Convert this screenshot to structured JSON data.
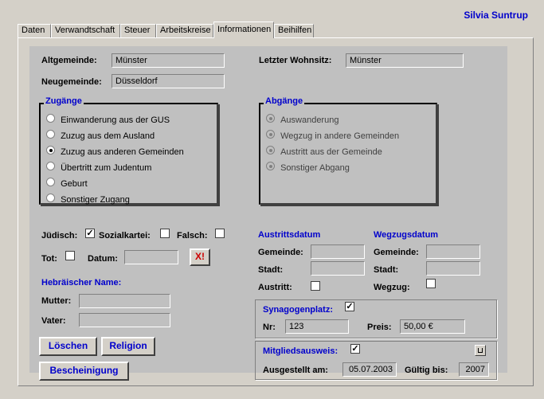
{
  "user": "Silvia Suntrup",
  "tabs": [
    "Daten",
    "Verwandtschaft",
    "Steuer",
    "Arbeitskreise",
    "Informationen",
    "Beihilfen"
  ],
  "altgemeinde": {
    "label": "Altgemeinde:",
    "value": "Münster"
  },
  "neugemeinde": {
    "label": "Neugemeinde:",
    "value": "Düsseldorf"
  },
  "wohnsitz": {
    "label": "Letzter Wohnsitz:",
    "value": "Münster"
  },
  "zugaenge": {
    "title": "Zugänge",
    "options": [
      "Einwanderung aus der GUS",
      "Zuzug aus dem Ausland",
      "Zuzug aus anderen Gemeinden",
      "Übertritt zum Judentum",
      "Geburt",
      "Sonstiger Zugang"
    ],
    "selected": 2
  },
  "abgaenge": {
    "title": "Abgänge",
    "options": [
      "Auswanderung",
      "Wegzug in andere Gemeinden",
      "Austritt aus der Gemeinde",
      "Sonstiger Abgang"
    ]
  },
  "juedisch": {
    "label": "Jüdisch:",
    "checked": "✓"
  },
  "sozialkartei": {
    "label": "Sozialkartei:"
  },
  "falsch": {
    "label": "Falsch:"
  },
  "tot": {
    "label": "Tot:"
  },
  "datum": {
    "label": "Datum:",
    "value": ""
  },
  "clear_icon": "X!",
  "hebr": {
    "title": "Hebräischer Name:",
    "mutter": "Mutter:",
    "vater": "Vater:"
  },
  "austritt": {
    "title": "Austrittsdatum",
    "gemeinde": "Gemeinde:",
    "stadt": "Stadt:",
    "check": "Austritt:"
  },
  "wegzug": {
    "title": "Wegzugsdatum",
    "gemeinde": "Gemeinde:",
    "stadt": "Stadt:",
    "check": "Wegzug:"
  },
  "synagoge": {
    "label": "Synagogenplatz:",
    "checked": "✓",
    "nr_label": "Nr:",
    "nr": "123",
    "preis_label": "Preis:",
    "preis": "50,00 €"
  },
  "mitglied": {
    "label": "Mitgliedsausweis:",
    "checked": "✓",
    "ausgestellt_label": "Ausgestellt am:",
    "ausgestellt": "05.07.2003",
    "gueltig_label": "Gültig bis:",
    "gueltig": "2007"
  },
  "buttons": {
    "loeschen": "Löschen",
    "religion": "Religion",
    "bescheinigung": "Bescheinigung"
  }
}
